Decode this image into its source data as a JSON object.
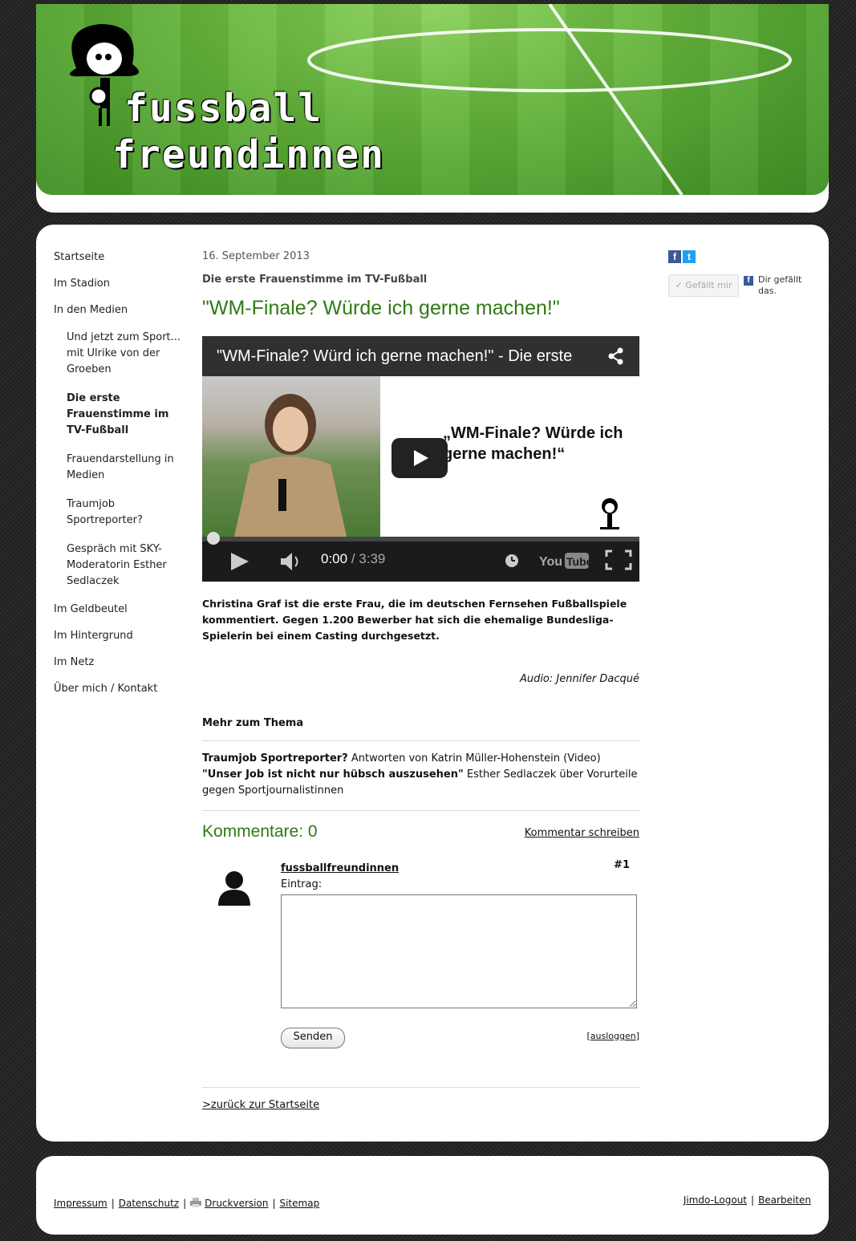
{
  "header": {
    "logo_line1": "fussball",
    "logo_line2": "freundinnen"
  },
  "nav": {
    "items": [
      {
        "label": "Startseite"
      },
      {
        "label": "Im Stadion"
      },
      {
        "label": "In den Medien"
      }
    ],
    "subitems": [
      {
        "label": "Und jetzt zum Sport... mit Ulrike von der Groeben"
      },
      {
        "label": "Die erste Frauenstimme im TV-Fußball"
      },
      {
        "label": "Frauendarstellung in Medien"
      },
      {
        "label": "Traumjob Sportreporter?"
      },
      {
        "label": "Gespräch mit SKY-Moderatorin Esther Sedlaczek"
      }
    ],
    "items_after": [
      {
        "label": "Im Geldbeutel"
      },
      {
        "label": "Im Hintergrund"
      },
      {
        "label": "Im Netz"
      },
      {
        "label": "Über mich / Kontakt"
      }
    ]
  },
  "article": {
    "date": "16. September 2013",
    "subtitle": "Die erste Frauenstimme im TV-Fußball",
    "headline": "\"WM-Finale? Würde ich gerne machen!\"",
    "video": {
      "title": "\"WM-Finale? Würd ich gerne machen!\" - Die erste",
      "quote": "„WM-Finale? Würde ich gerne machen!“",
      "time_current": "0:00",
      "time_total": "/ 3:39",
      "progress_fraction": 0.0
    },
    "lead": "Christina Graf ist die erste Frau, die im deutschen Fernsehen Fußballspiele kommentiert. Gegen 1.200 Bewerber hat sich die ehemalige Bundesliga-Spielerin bei einem Casting durchgesetzt.",
    "credit": "Audio: Jennifer Dacqué"
  },
  "more": {
    "title": "Mehr zum Thema",
    "link1_bold": "Traumjob Sportreporter?",
    "link1_rest": " Antworten von Katrin Müller-Hohenstein (Video)",
    "link2_bold": "\"Unser Job ist nicht nur hübsch auszusehen\"",
    "link2_rest": " Esther Sedlaczek über Vorurteile gegen Sportjournalistinnen"
  },
  "comments": {
    "title": "Kommentare: 0",
    "write_link": "Kommentar schreiben",
    "user": "fussballfreundinnen",
    "number": "#1",
    "entry_label": "Eintrag:",
    "send_label": "Senden",
    "logout_label": "ausloggen"
  },
  "back_link": ">zurück zur Startseite",
  "social": {
    "like_button": "✓ Gefällt mir",
    "like_text": "Dir gefällt das."
  },
  "footer": {
    "impressum": "Impressum",
    "datenschutz": "Datenschutz",
    "druckversion": "Druckversion",
    "sitemap": "Sitemap",
    "jimdo_logout": "Jimdo-Logout",
    "bearbeiten": "Bearbeiten"
  }
}
